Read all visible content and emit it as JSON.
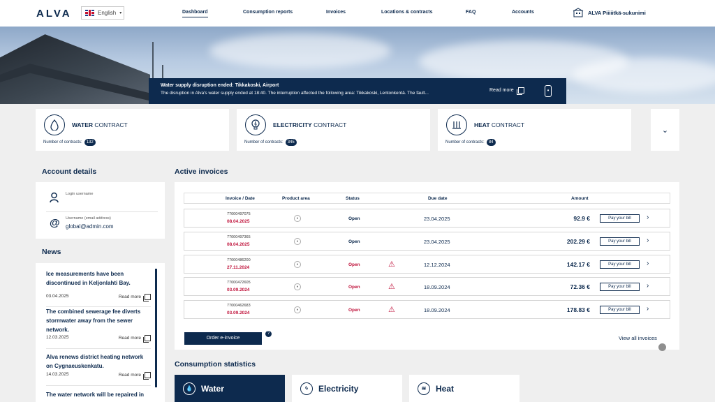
{
  "nav": {
    "logo": "ALVA",
    "language": "English",
    "links": [
      "Dashboard",
      "Consumption reports",
      "Invoices",
      "Locations & contracts",
      "FAQ",
      "Accounts"
    ],
    "user": "ALVA Piiiiitkä-sukunimi"
  },
  "banner": {
    "title": "Water supply disruption ended: Tikkakoski, Airport",
    "text": "The disruption in Alva's water supply ended at 18:40. The interruption affected the following area: Tikkakoski, Lentonkentä. The fault...",
    "read_more": "Read more"
  },
  "contracts": [
    {
      "name_bold": "WATER",
      "name_rest": " CONTRACT",
      "count_label": "Number of contracts:",
      "count": "132",
      "icon": "water-drop-icon"
    },
    {
      "name_bold": "ELECTRICITY",
      "name_rest": " CONTRACT",
      "count_label": "Number of contracts:",
      "count": "345",
      "icon": "lightbulb-icon"
    },
    {
      "name_bold": "HEAT",
      "name_rest": " CONTRACT",
      "count_label": "Number of contracts:",
      "count": "84",
      "icon": "heat-icon"
    }
  ],
  "account": {
    "title": "Account details",
    "login_label": "Login username",
    "login_value": "",
    "email_label": "Username (email address)",
    "email_value": "global@admin.com"
  },
  "news": {
    "title": "News",
    "read_more": "Read more",
    "items": [
      {
        "title": "Ice measurements have been discontinued in Keljonlahti Bay.",
        "date": "03.04.2025"
      },
      {
        "title": "The combined sewerage fee diverts stormwater away from the sewer network.",
        "date": "12.03.2025"
      },
      {
        "title": "Alva renews district heating network on Cygnaeuskenkatu.",
        "date": "14.03.2025"
      },
      {
        "title": "The water network will be repaired in",
        "date": ""
      }
    ]
  },
  "invoices": {
    "title": "Active invoices",
    "headers": {
      "invoice": "Invoice / Date",
      "product": "Product area",
      "status": "Status",
      "due": "Due date",
      "amount": "Amount"
    },
    "pay_label": "Pay your bill",
    "rows": [
      {
        "number": "77000497075",
        "date": "08.04.2025",
        "status": "Open",
        "overdue": false,
        "due": "23.04.2025",
        "amount": "92.9 €"
      },
      {
        "number": "77000497365",
        "date": "08.04.2025",
        "status": "Open",
        "overdue": false,
        "due": "23.04.2025",
        "amount": "202.29 €"
      },
      {
        "number": "77000486200",
        "date": "27.11.2024",
        "status": "Open",
        "overdue": true,
        "due": "12.12.2024",
        "amount": "142.17 €"
      },
      {
        "number": "77000472605",
        "date": "03.09.2024",
        "status": "Open",
        "overdue": true,
        "due": "18.09.2024",
        "amount": "72.36 €"
      },
      {
        "number": "77000462683",
        "date": "03.09.2024",
        "status": "Open",
        "overdue": true,
        "due": "18.09.2024",
        "amount": "178.83 €"
      }
    ],
    "order_label": "Order e-invoice",
    "help": "?",
    "view_all": "View all invoices"
  },
  "consumption": {
    "title": "Consumption statistics",
    "tabs": [
      "Water",
      "Electricity",
      "Heat"
    ]
  },
  "colors": {
    "brand": "#0d2a4e",
    "alert": "#c0143c"
  }
}
